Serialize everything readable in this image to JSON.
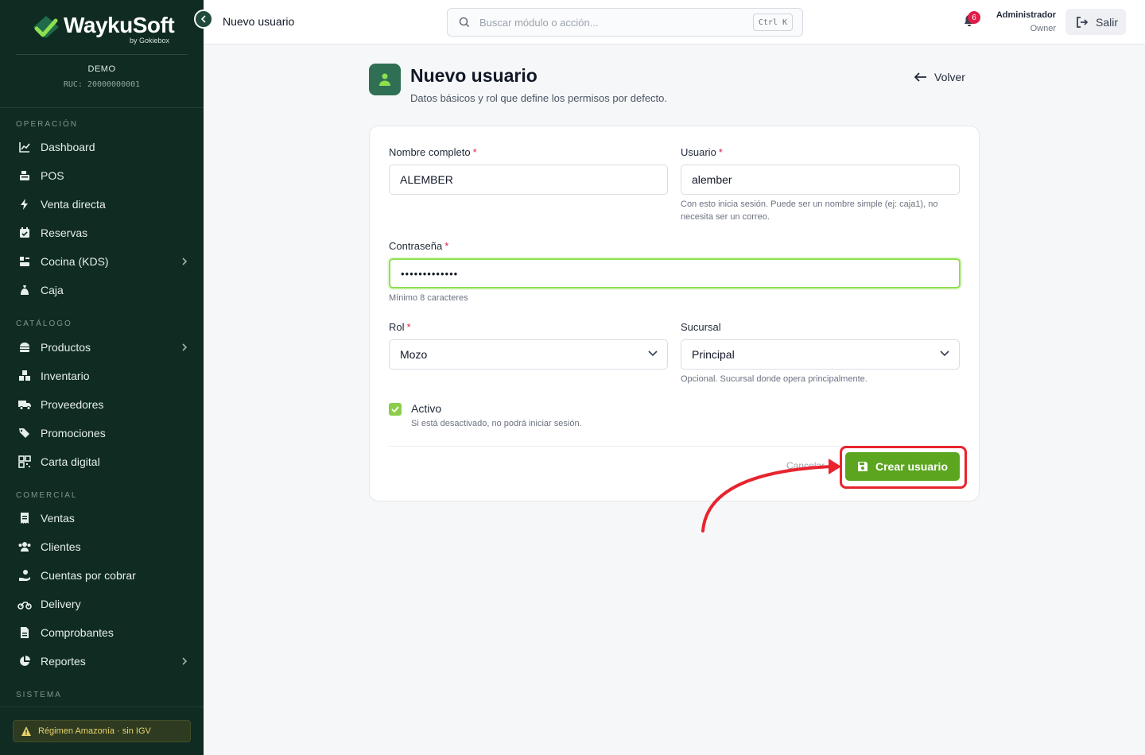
{
  "sidebar": {
    "brand_name": "WaykuSoft",
    "brand_sub": "by Gokiebox",
    "company": "DEMO",
    "ruc": "RUC: 20000000001",
    "sections": {
      "operacion": "OPERACIÓN",
      "catalogo": "CATÁLOGO",
      "comercial": "COMERCIAL",
      "sistema": "SISTEMA"
    },
    "items": {
      "dashboard": "Dashboard",
      "pos": "POS",
      "venta_directa": "Venta directa",
      "reservas": "Reservas",
      "cocina": "Cocina (KDS)",
      "caja": "Caja",
      "productos": "Productos",
      "inventario": "Inventario",
      "proveedores": "Proveedores",
      "promociones": "Promociones",
      "carta_digital": "Carta digital",
      "ventas": "Ventas",
      "clientes": "Clientes",
      "cuentas_por_cobrar": "Cuentas por cobrar",
      "delivery": "Delivery",
      "comprobantes": "Comprobantes",
      "reportes": "Reportes"
    },
    "regimen": "Régimen Amazonía · sin IGV"
  },
  "topbar": {
    "page": "Nuevo usuario",
    "search_placeholder": "Buscar módulo o acción...",
    "shortcut": "Ctrl K",
    "notifications": "6",
    "user_name": "Administrador",
    "user_role": "Owner",
    "logout": "Salir"
  },
  "header": {
    "title": "Nuevo usuario",
    "subtitle": "Datos básicos y rol que define los permisos por defecto.",
    "back": "Volver"
  },
  "form": {
    "full_name_label": "Nombre completo",
    "full_name_value": "ALEMBER",
    "username_label": "Usuario",
    "username_value": "alember",
    "username_hint": "Con esto inicia sesión. Puede ser un nombre simple (ej: caja1), no necesita ser un correo.",
    "password_label": "Contraseña",
    "password_value": "•••••••••••••",
    "password_hint": "Mínimo 8 caracteres",
    "role_label": "Rol",
    "role_value": "Mozo",
    "branch_label": "Sucursal",
    "branch_value": "Principal",
    "branch_hint": "Opcional. Sucursal donde opera principalmente.",
    "active_label": "Activo",
    "active_hint": "Si está desactivado, no podrá iniciar sesión.",
    "required_mark": "*",
    "cancel": "Cancelar",
    "submit": "Crear usuario"
  },
  "colors": {
    "sidebar_bg": "#0f2b22",
    "accent_green": "#5ba51f",
    "annotation_red": "#e8242e"
  }
}
